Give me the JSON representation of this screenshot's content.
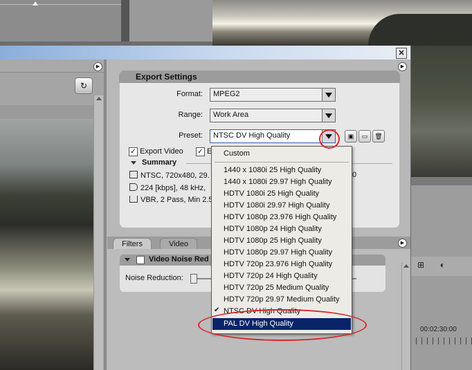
{
  "background": {
    "timecode": "00:02:30:00"
  },
  "dialog": {
    "close_label": "✕",
    "export_settings": {
      "title": "Export Settings",
      "format_label": "Format:",
      "format_value": "MPEG2",
      "range_label": "Range:",
      "range_value": "Work Area",
      "preset_label": "Preset:",
      "preset_value": "NTSC DV High Quality",
      "export_video_label": "Export Video",
      "export_audio_label_visible": "E",
      "summary_title": "Summary",
      "summary_lines": [
        "NTSC, 720x480, 29.",
        "224 [kbps], 48 kHz,",
        "VBR, 2 Pass, Min 2.5"
      ],
      "summary_trailing": "0"
    },
    "tabs": [
      "Filters",
      "Video"
    ],
    "filter": {
      "title": "Video Noise Red",
      "noise_label": "Noise Reduction:",
      "noise_value": "5"
    },
    "preset_dropdown": {
      "items": [
        "Custom",
        "1440 x 1080i 25 High Quality",
        "1440 x 1080i 29.97 High Quality",
        "HDTV 1080i 25 High Quality",
        "HDTV 1080i 29.97 High Quality",
        "HDTV 1080p 23.976 High Quality",
        "HDTV 1080p 24 High Quality",
        "HDTV 1080p 25 High Quality",
        "HDTV 1080p 29.97 High Quality",
        "HDTV 720p 23.976 High Quality",
        "HDTV 720p 24 High Quality",
        "HDTV 720p 25 Medium Quality",
        "HDTV 720p 29.97 Medium Quality",
        "NTSC DV High Quality",
        "PAL DV High Quality"
      ],
      "checked_item": "NTSC DV High Quality",
      "highlighted_item": "PAL DV High Quality"
    }
  },
  "colors": {
    "highlight": "#0a246a",
    "annotation_red": "#d8282a"
  }
}
